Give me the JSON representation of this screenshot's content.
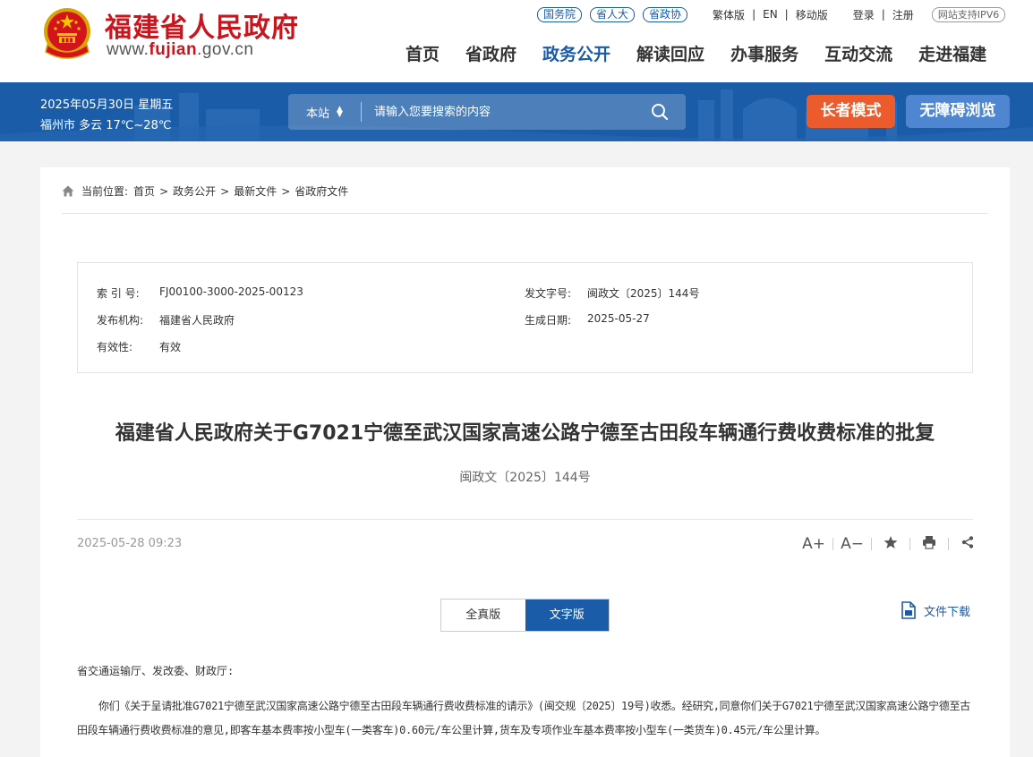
{
  "site": {
    "name": "福建省人民政府",
    "url_prefix": "www.",
    "url_domain": "fujian",
    "url_suffix": ".gov.cn"
  },
  "top_links": {
    "pills": [
      "国务院",
      "省人大",
      "省政协"
    ],
    "traditional": "繁体版",
    "english": "EN",
    "mobile": "移动版",
    "login": "登录",
    "register": "注册",
    "ipv6": "网站支持IPV6"
  },
  "nav": {
    "items": [
      {
        "label": "首页",
        "active": false
      },
      {
        "label": "省政府",
        "active": false
      },
      {
        "label": "政务公开",
        "active": true
      },
      {
        "label": "解读回应",
        "active": false
      },
      {
        "label": "办事服务",
        "active": false
      },
      {
        "label": "互动交流",
        "active": false
      },
      {
        "label": "走进福建",
        "active": false
      }
    ]
  },
  "banner": {
    "date": "2025年05月30日 星期五",
    "weather": "福州市 多云 17℃~28℃",
    "search_scope": "本站",
    "search_placeholder": "请输入您要搜索的内容",
    "elder_mode": "长者模式",
    "accessible": "无障碍浏览"
  },
  "breadcrumb": {
    "prefix": "当前位置:",
    "items": [
      "首页",
      "政务公开",
      "最新文件",
      "省政府文件"
    ]
  },
  "meta": {
    "index_label": "索 引 号:",
    "index_value": "FJ00100-3000-2025-00123",
    "docno_label": "发文字号:",
    "docno_value": "闽政文〔2025〕144号",
    "issuer_label": "发布机构:",
    "issuer_value": "福建省人民政府",
    "date_label": "生成日期:",
    "date_value": "2025-05-27",
    "validity_label": "有效性:",
    "validity_value": "有效"
  },
  "document": {
    "title": "福建省人民政府关于G7021宁德至武汉国家高速公路宁德至古田段车辆通行费收费标准的批复",
    "number": "闽政文〔2025〕144号",
    "publish_time": "2025-05-28 09:23",
    "tools": {
      "font_larger": "A+",
      "font_smaller": "A−"
    },
    "tabs": [
      "全真版",
      "文字版"
    ],
    "download": "文件下载",
    "addressee": "省交通运输厅、发改委、财政厅:",
    "paragraph": "你们《关于呈请批准G7021宁德至武汉国家高速公路宁德至古田段车辆通行费收费标准的请示》(闽交规〔2025〕19号)收悉。经研究,同意你们关于G7021宁德至武汉国家高速公路宁德至古田段车辆通行费收费标准的意见,即客车基本费率按小型车(一类客车)0.60元/车公里计算,货车及专项作业车基本费率按小型车(一类货车)0.45元/车公里计算。"
  },
  "colors": {
    "brand_red": "#c8161e",
    "brand_blue": "#1b5ca8",
    "elder_orange": "#ec5b2b",
    "access_blue": "#4f86d2"
  }
}
